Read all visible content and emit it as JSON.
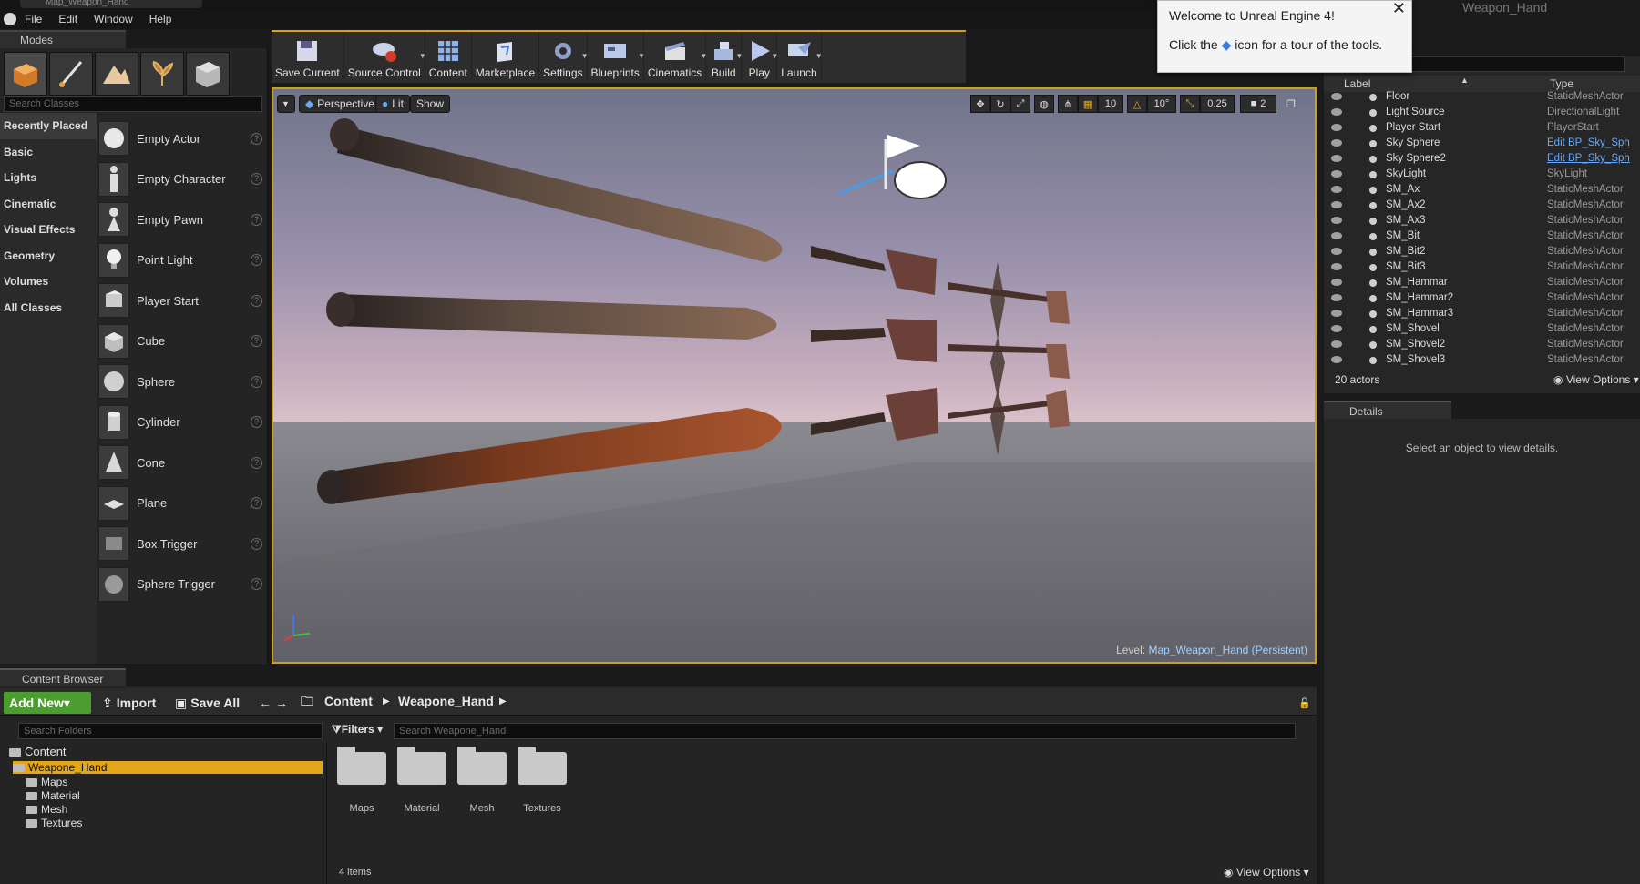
{
  "window": {
    "title": "Map_Weapon_Hand",
    "project_tab": "Weapon_Hand"
  },
  "menu": [
    "File",
    "Edit",
    "Window",
    "Help"
  ],
  "modes": {
    "tab_label": "Modes",
    "search_placeholder": "Search Classes",
    "categories": [
      "Recently Placed",
      "Basic",
      "Lights",
      "Cinematic",
      "Visual Effects",
      "Geometry",
      "Volumes",
      "All Classes"
    ],
    "classes": [
      "Empty Actor",
      "Empty Character",
      "Empty Pawn",
      "Point Light",
      "Player Start",
      "Cube",
      "Sphere",
      "Cylinder",
      "Cone",
      "Plane",
      "Box Trigger",
      "Sphere Trigger"
    ]
  },
  "toolbar": [
    "Save Current",
    "Source Control",
    "Content",
    "Marketplace",
    "Settings",
    "Blueprints",
    "Cinematics",
    "Build",
    "Play",
    "Launch"
  ],
  "viewport": {
    "perspective": "Perspective",
    "lit": "Lit",
    "show": "Show",
    "grid": "10",
    "rotation": "10°",
    "scale": "0.25",
    "camera_speed": "2",
    "level_prefix": "Level:",
    "level_name": "Map_Weapon_Hand (Persistent)"
  },
  "welcome": {
    "title": "Welcome to Unreal Engine 4!",
    "body_before": "Click the",
    "body_after": "icon for a tour of the tools.",
    "close": "✕"
  },
  "outliner": {
    "columns": [
      "Label",
      "Type"
    ],
    "rows": [
      {
        "label": "Floor",
        "type": "StaticMeshActor",
        "link": false
      },
      {
        "label": "Light Source",
        "type": "DirectionalLight",
        "link": false
      },
      {
        "label": "Player Start",
        "type": "PlayerStart",
        "link": false
      },
      {
        "label": "Sky Sphere",
        "type": "Edit BP_Sky_Sph",
        "link": true
      },
      {
        "label": "Sky Sphere2",
        "type": "Edit BP_Sky_Sph",
        "link": true
      },
      {
        "label": "SkyLight",
        "type": "SkyLight",
        "link": false
      },
      {
        "label": "SM_Ax",
        "type": "StaticMeshActor",
        "link": false
      },
      {
        "label": "SM_Ax2",
        "type": "StaticMeshActor",
        "link": false
      },
      {
        "label": "SM_Ax3",
        "type": "StaticMeshActor",
        "link": false
      },
      {
        "label": "SM_Bit",
        "type": "StaticMeshActor",
        "link": false
      },
      {
        "label": "SM_Bit2",
        "type": "StaticMeshActor",
        "link": false
      },
      {
        "label": "SM_Bit3",
        "type": "StaticMeshActor",
        "link": false
      },
      {
        "label": "SM_Hammar",
        "type": "StaticMeshActor",
        "link": false
      },
      {
        "label": "SM_Hammar2",
        "type": "StaticMeshActor",
        "link": false
      },
      {
        "label": "SM_Hammar3",
        "type": "StaticMeshActor",
        "link": false
      },
      {
        "label": "SM_Shovel",
        "type": "StaticMeshActor",
        "link": false
      },
      {
        "label": "SM_Shovel2",
        "type": "StaticMeshActor",
        "link": false
      },
      {
        "label": "SM_Shovel3",
        "type": "StaticMeshActor",
        "link": false
      }
    ],
    "count": "20 actors",
    "view_options": "View Options"
  },
  "details": {
    "tab_label": "Details",
    "empty_message": "Select an object to view details."
  },
  "content_browser": {
    "tab_label": "Content Browser",
    "add_new": "Add New",
    "import": "Import",
    "save_all": "Save All",
    "breadcrumb": [
      "Content",
      "Weapone_Hand"
    ],
    "folder_search_placeholder": "Search Folders",
    "filters": "Filters",
    "asset_search_placeholder": "Search Weapone_Hand",
    "tree": {
      "root": "Content",
      "selected": "Weapone_Hand",
      "children": [
        "Maps",
        "Material",
        "Mesh",
        "Textures"
      ]
    },
    "assets": [
      "Maps",
      "Material",
      "Mesh",
      "Textures"
    ],
    "item_count": "4 items",
    "view_options": "View Options"
  },
  "colors": {
    "accent": "#e3a51a",
    "add_new": "#4b9d30",
    "link": "#66aaff"
  }
}
